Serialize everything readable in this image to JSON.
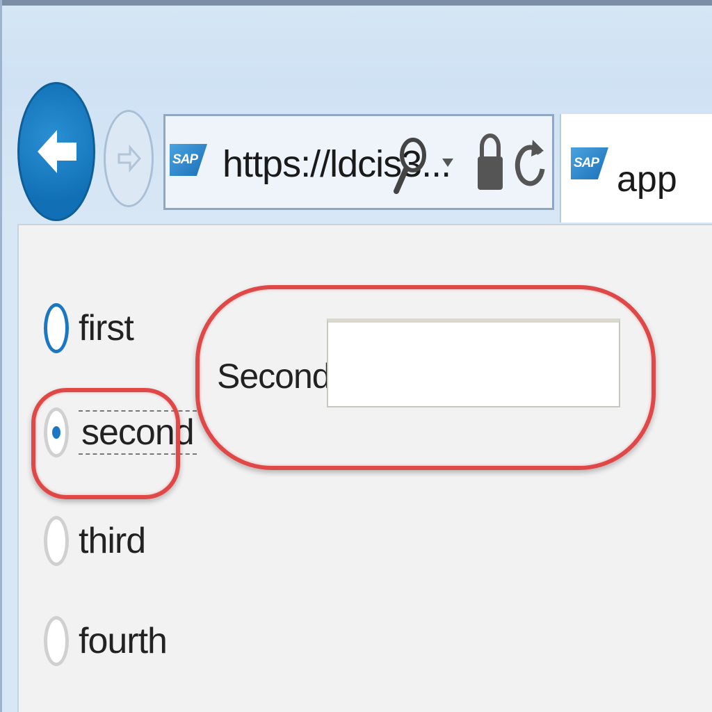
{
  "browser": {
    "back_label": "Back",
    "forward_label": "Forward",
    "address": {
      "logo_text": "SAP",
      "url": "https://ldcis3..."
    },
    "tab": {
      "logo_text": "SAP",
      "title": "app"
    }
  },
  "form": {
    "radio_options": [
      {
        "label": "first",
        "selected": false
      },
      {
        "label": "second",
        "selected": true
      },
      {
        "label": "third",
        "selected": false
      },
      {
        "label": "fourth",
        "selected": false
      }
    ],
    "field": {
      "label": "Second:",
      "value": "",
      "placeholder": ""
    }
  },
  "colors": {
    "highlight": "#e04848",
    "accent": "#1b76c4",
    "content_bg": "#f2f2f2"
  }
}
